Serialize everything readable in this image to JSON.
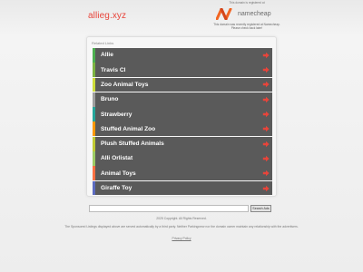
{
  "header": {
    "domain": "allieg.xyz",
    "registrar_top": "This domain is registered at",
    "registrar_name": "namecheap",
    "registrar_note": "This domain was recently registered at Namecheap. Please check back later!"
  },
  "panel": {
    "title": "Related Links",
    "links": [
      {
        "label": "Allie",
        "accent": "#4caf50"
      },
      {
        "label": "Travis Cl",
        "accent": "#7cb342"
      },
      {
        "label": "Zoo Animal Toys",
        "accent": "#cddc39"
      },
      {
        "label": "Bruno",
        "accent": "#9e9e9e"
      },
      {
        "label": "Strawberry",
        "accent": "#26a69a"
      },
      {
        "label": "Stuffed Animal Zoo",
        "accent": "#ff9800"
      },
      {
        "label": "Plush Stuffed Animals",
        "accent": "#c0ca33"
      },
      {
        "label": "Alli Orlistat",
        "accent": "#9ccc65"
      },
      {
        "label": "Animal Toys",
        "accent": "#ff7043"
      },
      {
        "label": "Giraffe Toy",
        "accent": "#5c6bc0"
      }
    ],
    "arrow_color": "#e8443a",
    "row_color": "#5a5a5a"
  },
  "search": {
    "value": "",
    "button_label": "Search Ads"
  },
  "footer": {
    "copyright": "2025 Copyright. All Rights Reserved.",
    "disclaimer": "The Sponsored Listings displayed above are served automatically by a third party. Neither Parkingcrew nor the domain owner maintain any relationship with the advertisers.",
    "privacy": "Privacy Policy"
  },
  "colors": {
    "brand_orange": "#f26522",
    "domain_red": "#e8443a"
  }
}
